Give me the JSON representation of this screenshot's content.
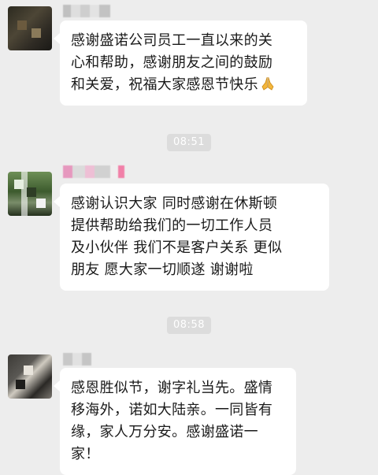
{
  "messages": [
    {
      "lines": [
        "感谢盛诺公司员工一直以来的关",
        "心和帮助，感谢朋友之间的鼓励",
        "和关爱，祝福大家感恩节快乐"
      ],
      "emoji": "praying-hands"
    },
    {
      "time": "08:51",
      "lines": [
        "感谢认识大家 同时感谢在休斯顿",
        "提供帮助给我们的一切工作人员",
        "及小伙伴 我们不是客户关系 更似",
        "朋友 愿大家一切顺遂 谢谢啦"
      ]
    },
    {
      "time": "08:58",
      "lines": [
        "感恩胜似节，谢字礼当先。盛情",
        "移海外，诺如大陆亲。一同皆有",
        "缘，家人万分安。感谢盛诺一",
        "家！"
      ]
    }
  ],
  "colors": {
    "background": "#ededed",
    "bubble": "#ffffff",
    "timestamp_bg": "#dcdcdc"
  }
}
